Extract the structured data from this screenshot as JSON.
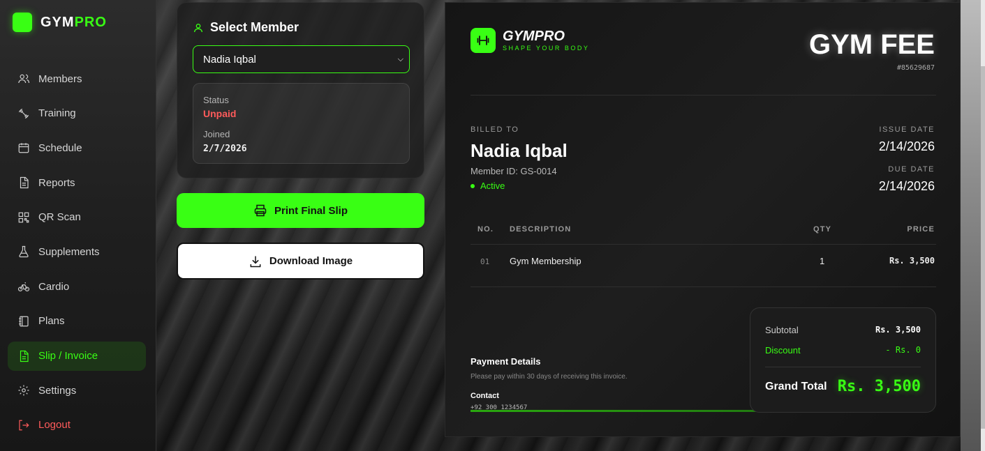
{
  "brand": {
    "name_main": "GYM",
    "name_accent": "PRO",
    "accent_color": "#39ff14"
  },
  "sidebar": {
    "items": [
      {
        "label": "Members",
        "icon": "users-icon"
      },
      {
        "label": "Training",
        "icon": "dumbbell-icon"
      },
      {
        "label": "Schedule",
        "icon": "calendar-icon"
      },
      {
        "label": "Reports",
        "icon": "document-icon"
      },
      {
        "label": "QR Scan",
        "icon": "qr-icon"
      },
      {
        "label": "Supplements",
        "icon": "flask-icon"
      },
      {
        "label": "Cardio",
        "icon": "bicycle-icon"
      },
      {
        "label": "Plans",
        "icon": "notebook-icon"
      },
      {
        "label": "Slip / Invoice",
        "icon": "invoice-icon",
        "active": true
      },
      {
        "label": "Settings",
        "icon": "gear-icon"
      },
      {
        "label": "Logout",
        "icon": "logout-icon"
      }
    ]
  },
  "select_member": {
    "title": "Select Member",
    "selected": "Nadia Iqbal",
    "status_label": "Status",
    "status_value": "Unpaid",
    "joined_label": "Joined",
    "joined_value": "2/7/2026"
  },
  "actions": {
    "print_label": "Print Final Slip",
    "download_label": "Download Image"
  },
  "invoice": {
    "brand": "GYMPRO",
    "tagline": "SHAPE YOUR BODY",
    "title": "GYM FEE",
    "number": "#85629687",
    "billed_to_label": "BILLED TO",
    "member_name": "Nadia Iqbal",
    "member_id": "Member ID: GS-0014",
    "member_status": "Active",
    "issue_date_label": "ISSUE DATE",
    "issue_date": "2/14/2026",
    "due_date_label": "DUE DATE",
    "due_date": "2/14/2026",
    "columns": {
      "no": "NO.",
      "description": "DESCRIPTION",
      "qty": "QTY",
      "price": "PRICE"
    },
    "items": [
      {
        "no": "01",
        "description": "Gym Membership",
        "qty": "1",
        "price": "Rs. 3,500"
      }
    ],
    "payment_title": "Payment Details",
    "payment_note": "Please pay within 30 days of receiving this invoice.",
    "contact_title": "Contact",
    "contact_phone": "+92 300 1234567",
    "subtotal_label": "Subtotal",
    "subtotal_value": "Rs. 3,500",
    "discount_label": "Discount",
    "discount_value": "- Rs. 0",
    "grand_total_label": "Grand Total",
    "grand_total_value": "Rs. 3,500"
  }
}
